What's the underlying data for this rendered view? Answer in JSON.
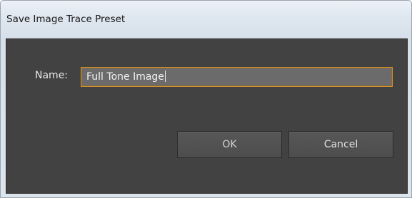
{
  "window": {
    "title": "Save Image Trace Preset"
  },
  "form": {
    "name_label": "Name:",
    "name_value": "Full Tone Image"
  },
  "buttons": {
    "ok_label": "OK",
    "cancel_label": "Cancel"
  },
  "colors": {
    "dialog_background": "#424242",
    "input_background": "#6b6b6b",
    "input_focus_border": "#d8922f",
    "titlebar_background": "#dfe7f0"
  }
}
